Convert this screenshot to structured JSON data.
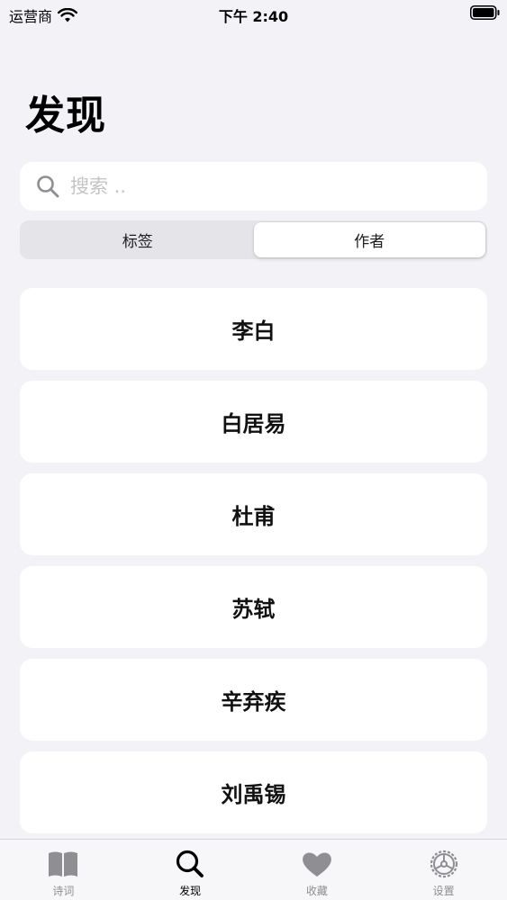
{
  "status": {
    "carrier": "运营商",
    "time": "下午 2:40"
  },
  "page": {
    "title": "发现"
  },
  "search": {
    "placeholder": "搜索 ..",
    "value": ""
  },
  "segments": [
    {
      "label": "标签",
      "selected": false
    },
    {
      "label": "作者",
      "selected": true
    }
  ],
  "authors": [
    {
      "name": "李白"
    },
    {
      "name": "白居易"
    },
    {
      "name": "杜甫"
    },
    {
      "name": "苏轼"
    },
    {
      "name": "辛弃疾"
    },
    {
      "name": "刘禹锡"
    }
  ],
  "tabs": [
    {
      "label": "诗词",
      "icon": "book-icon",
      "active": false
    },
    {
      "label": "发现",
      "icon": "search-icon",
      "active": true
    },
    {
      "label": "收藏",
      "icon": "heart-icon",
      "active": false
    },
    {
      "label": "设置",
      "icon": "gear-icon",
      "active": false
    }
  ],
  "colors": {
    "background": "#f2f2f7",
    "card": "#ffffff",
    "tab_inactive": "#8e8e93",
    "tab_active": "#000000"
  }
}
